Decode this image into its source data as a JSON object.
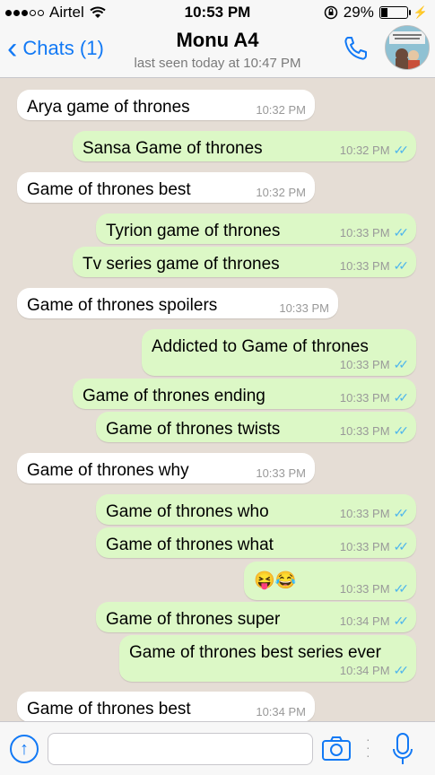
{
  "status": {
    "carrier": "Airtel",
    "time": "10:53 PM",
    "battery": "29%",
    "battery_level": 0.29
  },
  "header": {
    "back_label": "Chats (1)",
    "contact_name": "Monu A4",
    "last_seen": "last seen today at 10:47 PM"
  },
  "messages": [
    {
      "dir": "in",
      "text": "Arya game of thrones",
      "time": "10:32 PM"
    },
    {
      "dir": "out",
      "text": "Sansa Game of thrones",
      "time": "10:32 PM"
    },
    {
      "dir": "in",
      "text": "Game of thrones best",
      "time": "10:32 PM"
    },
    {
      "dir": "out",
      "text": "Tyrion game of thrones",
      "time": "10:33 PM"
    },
    {
      "dir": "out",
      "text": "Tv series game of thrones",
      "time": "10:33 PM"
    },
    {
      "dir": "in",
      "text": "Game of thrones spoilers",
      "time": "10:33 PM"
    },
    {
      "dir": "out",
      "text": "Addicted to Game of thrones",
      "time": "10:33 PM"
    },
    {
      "dir": "out",
      "text": "Game of thrones ending",
      "time": "10:33 PM"
    },
    {
      "dir": "out",
      "text": "Game of thrones twists",
      "time": "10:33 PM"
    },
    {
      "dir": "in",
      "text": "Game of thrones why",
      "time": "10:33 PM"
    },
    {
      "dir": "out",
      "text": "Game of thrones who",
      "time": "10:33 PM"
    },
    {
      "dir": "out",
      "text": "Game of thrones what",
      "time": "10:33 PM"
    },
    {
      "dir": "out",
      "text": "😝😂",
      "time": "10:33 PM"
    },
    {
      "dir": "out",
      "text": "Game of thrones super",
      "time": "10:34 PM"
    },
    {
      "dir": "out",
      "text": "Game of thrones best series ever",
      "time": "10:34 PM"
    },
    {
      "dir": "in",
      "text": "Game of thrones best",
      "time": "10:34 PM"
    }
  ],
  "colors": {
    "accent": "#1279f5",
    "outgoing": "#dcf8c6",
    "incoming": "#ffffff",
    "read_tick": "#4fb6ec"
  },
  "icons": {
    "back": "chevron-left-icon",
    "call": "phone-icon",
    "attach": "upload-icon",
    "camera": "camera-icon",
    "voice": "microphone-icon"
  }
}
